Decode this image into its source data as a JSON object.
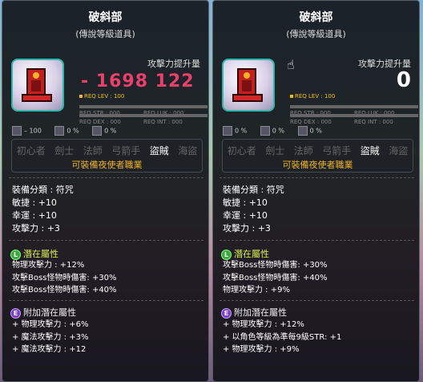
{
  "left": {
    "title": "破斜部",
    "subtitle": "(傳說等級道具)",
    "atk_label": "攻擊力提升量",
    "atk_value": "- 1698 122",
    "req_lev": "REQ LEV : 100",
    "req_str": "REQ STR : 000",
    "req_luk": "REQ LUK : 000",
    "req_dex": "REQ DEX : 000",
    "req_int": "REQ INT : 000",
    "stat_a": "– 100",
    "stat_b": "0 %",
    "stat_c": "0 %",
    "jobs": [
      "初心者",
      "劍士",
      "法師",
      "弓箭手",
      "盜賊",
      "海盜"
    ],
    "job_note": "可裝備夜使者職業",
    "base": [
      "裝備分類 : 符咒",
      "敏捷 : +10",
      "幸運 : +10",
      "攻擊力 : +3"
    ],
    "potential_title": "潛在屬性",
    "potential": [
      "物理攻擊力 : +12%",
      "攻擊Boss怪物時傷害: +30%",
      "攻擊Boss怪物時傷害: +40%"
    ],
    "bonus_title": "附加潛在屬性",
    "bonus": [
      "+ 物理攻擊力 : +6%",
      "+ 魔法攻擊力 : +3%",
      "+ 魔法攻擊力 : +12"
    ]
  },
  "right": {
    "title": "破斜部",
    "subtitle": "(傳說等級道具)",
    "atk_label": "攻擊力提升量",
    "atk_value": "0",
    "req_lev": "REQ LEV : 100",
    "req_str": "REQ STR : 000",
    "req_luk": "REQ LUK : 000",
    "req_dex": "REQ DEX : 000",
    "req_int": "REQ INT : 000",
    "stat_a": "0 %",
    "stat_b": "0 %",
    "stat_c": "0 %",
    "jobs": [
      "初心者",
      "劍士",
      "法師",
      "弓箭手",
      "盜賊",
      "海盜"
    ],
    "job_note": "可裝備夜使者職業",
    "base": [
      "裝備分類 : 符咒",
      "敏捷 : +10",
      "幸運 : +10",
      "攻擊力 : +3"
    ],
    "potential_title": "潛在屬性",
    "potential": [
      "攻擊Boss怪物時傷害: +30%",
      "攻擊Boss怪物時傷害: +40%",
      "物理攻擊力 : +9%"
    ],
    "bonus_title": "附加潛在屬性",
    "bonus": [
      "+ 物理攻擊力 : +12%",
      "+ 以角色等級為準每9級STR: +1",
      "+ 物理攻擊力 : +9%"
    ]
  },
  "badges": {
    "potential": "L",
    "bonus": "E"
  },
  "colors": {
    "gold": "#f0b428",
    "teal": "#2fb8ad",
    "pink": "#e8416c",
    "green": "#d8f058"
  }
}
